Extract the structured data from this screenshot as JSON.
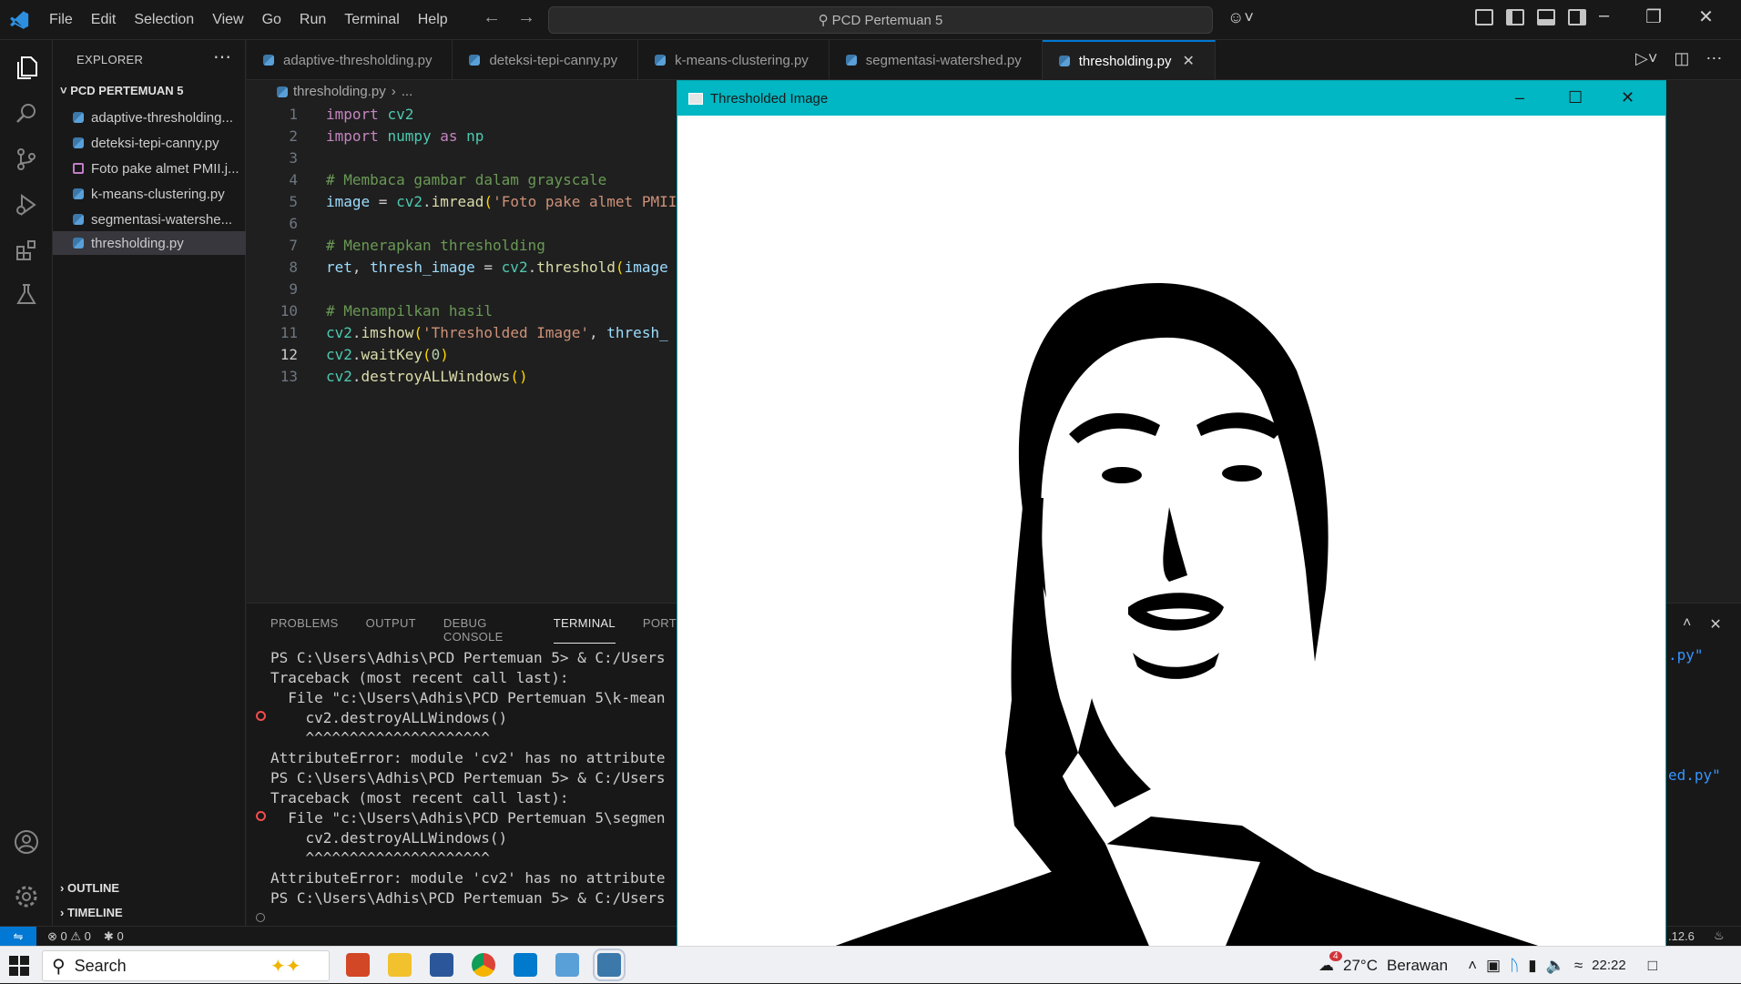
{
  "window": {
    "search_text": "PCD Pertemuan 5"
  },
  "menu": [
    "File",
    "Edit",
    "Selection",
    "View",
    "Go",
    "Run",
    "Terminal",
    "Help"
  ],
  "explorer": {
    "title": "EXPLORER",
    "folder": "PCD PERTEMUAN 5",
    "files": [
      "adaptive-thresholding...",
      "deteksi-tepi-canny.py",
      "Foto pake almet PMII.j...",
      "k-means-clustering.py",
      "segmentasi-watershe...",
      "thresholding.py"
    ],
    "sections": [
      "OUTLINE",
      "TIMELINE"
    ]
  },
  "tabs": [
    "adaptive-thresholding.py",
    "deteksi-tepi-canny.py",
    "k-means-clustering.py",
    "segmentasi-watershed.py",
    "thresholding.py"
  ],
  "breadcrumb": {
    "file": "thresholding.py",
    "rest": "..."
  },
  "editor": {
    "line_numbers": [
      "1",
      "2",
      "3",
      "4",
      "5",
      "6",
      "7",
      "8",
      "9",
      "10",
      "11",
      "12",
      "13"
    ],
    "current_line": "12"
  },
  "panel": {
    "tabs": [
      "PROBLEMS",
      "OUTPUT",
      "DEBUG CONSOLE",
      "TERMINAL",
      "PORT"
    ],
    "active_tab": "TERMINAL",
    "terminal_lines": [
      "PS C:\\Users\\Adhis\\PCD Pertemuan 5> & C:/Users",
      "Traceback (most recent call last):",
      "  File \"c:\\Users\\Adhis\\PCD Pertemuan 5\\k-mean",
      "    cv2.destroyALLWindows()",
      "    ^^^^^^^^^^^^^^^^^^^^^",
      "AttributeError: module 'cv2' has no attribute",
      "PS C:\\Users\\Adhis\\PCD Pertemuan 5> & C:/Users",
      "Traceback (most recent call last):",
      "  File \"c:\\Users\\Adhis\\PCD Pertemuan 5\\segmen",
      "    cv2.destroyALLWindows()",
      "    ^^^^^^^^^^^^^^^^^^^^^",
      "AttributeError: module 'cv2' has no attribute",
      "PS C:\\Users\\Adhis\\PCD Pertemuan 5> & C:/Users"
    ],
    "right_fragments": [
      ".py\"",
      "ed.py\""
    ]
  },
  "statusbar": {
    "errors": "0",
    "warnings": "0",
    "ports": "0",
    "version": ".12.6"
  },
  "image_window": {
    "title": "Thresholded Image"
  },
  "taskbar": {
    "search_placeholder": "Search",
    "weather_temp": "27°C",
    "weather_text": "Berawan",
    "weather_badge": "4",
    "time": "22:22"
  },
  "colors": {
    "accent": "#0078d4",
    "cv_titlebar": "#00b7c3"
  }
}
